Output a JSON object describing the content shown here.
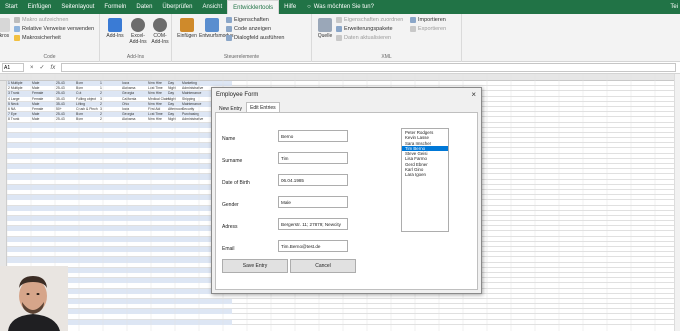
{
  "ribbon_tabs": [
    "Start",
    "Einfügen",
    "Seitenlayout",
    "Formeln",
    "Daten",
    "Überprüfen",
    "Ansicht",
    "Entwicklertools",
    "Hilfe"
  ],
  "active_tab_index": 7,
  "tell_me": "Was möchten Sie tun?",
  "user_initials": "Tei",
  "ribbon": {
    "code_group": {
      "label": "Code",
      "record_macro": "Makro aufzeichnen",
      "relative_refs": "Relative Verweise verwenden",
      "macro_security": "Makrosicherheit",
      "macros_partial": "akros"
    },
    "addins_group": {
      "label": "Add-Ins",
      "addins": "Add-Ins",
      "excel_addins": "Excel-Add-Ins",
      "com_addins": "COM-Add-Ins"
    },
    "controls_group": {
      "label": "Steuerelemente",
      "insert": "Einfügen",
      "design_mode": "Entwurfsmodus",
      "properties": "Eigenschaften",
      "view_code": "Code anzeigen",
      "run_dialog": "Dialogfeld ausführen"
    },
    "xml_group": {
      "label": "XML",
      "source": "Quelle",
      "map_properties": "Eigenschaften zuordnen",
      "expansion_packs": "Erweiterungspakete",
      "refresh_data": "Daten aktualisieren",
      "import": "Importieren",
      "export": "Exportieren"
    }
  },
  "formula_bar": {
    "namebox": "A1",
    "cancel": "×",
    "enter": "✓",
    "fx": "fx"
  },
  "colors": {
    "excel_green": "#217346",
    "selected_blue": "#0078d7",
    "table_band": "#dde6f4"
  },
  "dialog": {
    "title": "Employee Form",
    "close": "×",
    "tabs": [
      "New Entry",
      "Edit Entries"
    ],
    "active_tab_index": 1,
    "fields": [
      {
        "label": "Name",
        "value": "Berno"
      },
      {
        "label": "Surname",
        "value": "Tim"
      },
      {
        "label": "Date of Birth",
        "value": "06.04.1985"
      },
      {
        "label": "Gender",
        "value": "Male"
      },
      {
        "label": "Adress",
        "value": "Bergerstr. 11; 27879; Newcity"
      },
      {
        "label": "Email",
        "value": "Tim.Berno@test.de"
      }
    ],
    "list_items": [
      "Peter Rodgers",
      "Kevin Lasse",
      "Sara Imscher",
      "Tim Berno",
      "Steve Geisi",
      "Lisa Farmo",
      "Gerd Ebner",
      "Karl Gino",
      "Lara Igoen"
    ],
    "selected_index": 3,
    "save_button": "Save Entry",
    "cancel_button": "Cancel"
  },
  "sheet_rows": [
    [
      "1 Multiple",
      "Male",
      "25-43",
      "Burn",
      "1",
      "Iowa",
      "New Hire",
      "Day",
      "Marketing"
    ],
    [
      "2 Multiple",
      "Male",
      "25-43",
      "Burn",
      "1",
      "Alabama",
      "Lost Time",
      "Night",
      "Administrative"
    ],
    [
      "3 Trunk",
      "Female",
      "25-43",
      "Cut",
      "2",
      "Georgia",
      "New Hire",
      "Day",
      "Maintenance"
    ],
    [
      "4 Large",
      "Female",
      "35-43",
      "Falling object",
      "3",
      "California",
      "Medical Claim",
      "Night",
      "Shipping"
    ],
    [
      "5 Neck",
      "Male",
      "35-43",
      "Lifting",
      "2",
      "Ohio",
      "New Hire",
      "Day",
      "Maintenance"
    ],
    [
      "6 NA",
      "Female",
      "50+",
      "Crush & Pinch",
      "3",
      "Iowa",
      "First Aid",
      "Afternoon",
      "Security"
    ],
    [
      "7 Eye",
      "Male",
      "25-43",
      "Burn",
      "2",
      "Georgia",
      "Lost Time",
      "Day",
      "Purchasing"
    ],
    [
      "8 Trunk",
      "Male",
      "25-43",
      "Burn",
      "2",
      "Alabama",
      "New Hire",
      "Night",
      "Administrative"
    ]
  ]
}
